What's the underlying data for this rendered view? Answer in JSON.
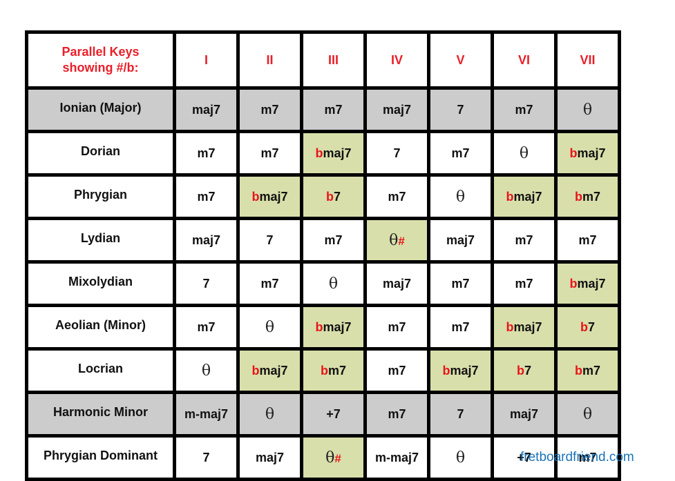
{
  "header": {
    "corner_line1": "Parallel Keys",
    "corner_line2": "showing #/b:",
    "degrees": [
      "I",
      "II",
      "III",
      "IV",
      "V",
      "VI",
      "VII"
    ]
  },
  "colors": {
    "header_text": "#e8202a",
    "accidental": "#e8131b",
    "highlight_bg": "#d8dfaa",
    "gray_row_bg": "#cccccc",
    "footer_link": "#1a73b8"
  },
  "rows": [
    {
      "mode": "Ionian (Major)",
      "gray": true,
      "cells": [
        {
          "acc": "",
          "chord": "maj7",
          "hl": false
        },
        {
          "acc": "",
          "chord": "m7",
          "hl": false
        },
        {
          "acc": "",
          "chord": "m7",
          "hl": false
        },
        {
          "acc": "",
          "chord": "maj7",
          "hl": false
        },
        {
          "acc": "",
          "chord": "7",
          "hl": false
        },
        {
          "acc": "",
          "chord": "m7",
          "hl": false
        },
        {
          "acc": "",
          "chord": "θ",
          "hl": false,
          "theta": true
        }
      ]
    },
    {
      "mode": "Dorian",
      "gray": false,
      "cells": [
        {
          "acc": "",
          "chord": "m7",
          "hl": false
        },
        {
          "acc": "",
          "chord": "m7",
          "hl": false
        },
        {
          "acc": "b",
          "chord": "maj7",
          "hl": true
        },
        {
          "acc": "",
          "chord": "7",
          "hl": false
        },
        {
          "acc": "",
          "chord": "m7",
          "hl": false
        },
        {
          "acc": "",
          "chord": "θ",
          "hl": false,
          "theta": true
        },
        {
          "acc": "b",
          "chord": "maj7",
          "hl": true
        }
      ]
    },
    {
      "mode": "Phrygian",
      "gray": false,
      "cells": [
        {
          "acc": "",
          "chord": "m7",
          "hl": false
        },
        {
          "acc": "b",
          "chord": "maj7",
          "hl": true
        },
        {
          "acc": "b",
          "chord": "7",
          "hl": true
        },
        {
          "acc": "",
          "chord": "m7",
          "hl": false
        },
        {
          "acc": "",
          "chord": "θ",
          "hl": false,
          "theta": true
        },
        {
          "acc": "b",
          "chord": "maj7",
          "hl": true
        },
        {
          "acc": "b",
          "chord": "m7",
          "hl": true
        }
      ]
    },
    {
      "mode": "Lydian",
      "gray": false,
      "cells": [
        {
          "acc": "",
          "chord": "maj7",
          "hl": false
        },
        {
          "acc": "",
          "chord": "7",
          "hl": false
        },
        {
          "acc": "",
          "chord": "m7",
          "hl": false
        },
        {
          "acc": "",
          "chord": "θ",
          "hl": true,
          "theta": true,
          "sharp": "#"
        },
        {
          "acc": "",
          "chord": "maj7",
          "hl": false
        },
        {
          "acc": "",
          "chord": "m7",
          "hl": false
        },
        {
          "acc": "",
          "chord": "m7",
          "hl": false
        }
      ]
    },
    {
      "mode": "Mixolydian",
      "gray": false,
      "cells": [
        {
          "acc": "",
          "chord": "7",
          "hl": false
        },
        {
          "acc": "",
          "chord": "m7",
          "hl": false
        },
        {
          "acc": "",
          "chord": "θ",
          "hl": false,
          "theta": true
        },
        {
          "acc": "",
          "chord": "maj7",
          "hl": false
        },
        {
          "acc": "",
          "chord": "m7",
          "hl": false
        },
        {
          "acc": "",
          "chord": "m7",
          "hl": false
        },
        {
          "acc": "b",
          "chord": "maj7",
          "hl": true
        }
      ]
    },
    {
      "mode": "Aeolian (Minor)",
      "gray": false,
      "cells": [
        {
          "acc": "",
          "chord": "m7",
          "hl": false
        },
        {
          "acc": "",
          "chord": "θ",
          "hl": false,
          "theta": true
        },
        {
          "acc": "b",
          "chord": "maj7",
          "hl": true
        },
        {
          "acc": "",
          "chord": "m7",
          "hl": false
        },
        {
          "acc": "",
          "chord": "m7",
          "hl": false
        },
        {
          "acc": "b",
          "chord": "maj7",
          "hl": true
        },
        {
          "acc": "b",
          "chord": "7",
          "hl": true
        }
      ]
    },
    {
      "mode": "Locrian",
      "gray": false,
      "cells": [
        {
          "acc": "",
          "chord": "θ",
          "hl": false,
          "theta": true
        },
        {
          "acc": "b",
          "chord": "maj7",
          "hl": true
        },
        {
          "acc": "b",
          "chord": "m7",
          "hl": true
        },
        {
          "acc": "",
          "chord": "m7",
          "hl": false
        },
        {
          "acc": "b",
          "chord": "maj7",
          "hl": true
        },
        {
          "acc": "b",
          "chord": "7",
          "hl": true
        },
        {
          "acc": "b",
          "chord": "m7",
          "hl": true
        }
      ]
    },
    {
      "mode": "Harmonic Minor",
      "gray": true,
      "cells": [
        {
          "acc": "",
          "chord": "m-maj7",
          "hl": false
        },
        {
          "acc": "",
          "chord": "θ",
          "hl": false,
          "theta": true
        },
        {
          "acc": "",
          "chord": "+7",
          "hl": false
        },
        {
          "acc": "",
          "chord": "m7",
          "hl": false
        },
        {
          "acc": "",
          "chord": "7",
          "hl": false
        },
        {
          "acc": "",
          "chord": "maj7",
          "hl": false
        },
        {
          "acc": "",
          "chord": "θ",
          "hl": false,
          "theta": true
        }
      ]
    },
    {
      "mode": "Phrygian Dominant",
      "gray": false,
      "cells": [
        {
          "acc": "",
          "chord": "7",
          "hl": false
        },
        {
          "acc": "",
          "chord": "maj7",
          "hl": false
        },
        {
          "acc": "",
          "chord": "θ",
          "hl": true,
          "theta": true,
          "sharp": "#"
        },
        {
          "acc": "",
          "chord": "m-maj7",
          "hl": false
        },
        {
          "acc": "",
          "chord": "θ",
          "hl": false,
          "theta": true
        },
        {
          "acc": "",
          "chord": "+7",
          "hl": false
        },
        {
          "acc": "",
          "chord": "m7",
          "hl": false
        }
      ]
    }
  ],
  "footer": {
    "site": "fretboardfriend.com"
  }
}
